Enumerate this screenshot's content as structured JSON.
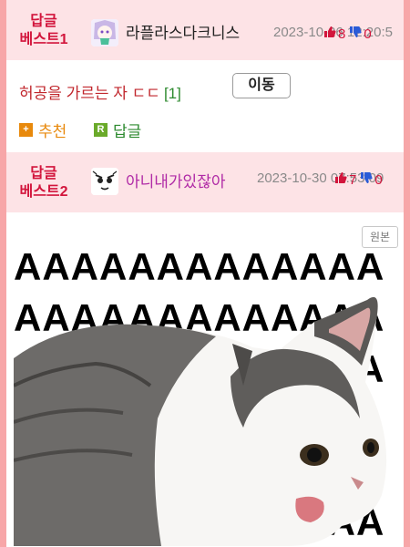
{
  "best1": {
    "label_line1": "답글",
    "label_line2": "베스트1",
    "nickname": "라플라스다크니스",
    "date": "2023-10-26",
    "time": "12:20:5",
    "votes_up": "8",
    "votes_down": "0"
  },
  "reply": {
    "title": "허공을 가르는 자 ㄷㄷ",
    "count": "[1]",
    "move_label": "이동",
    "recommend_label": "추천",
    "reply_label": "답글",
    "recommend_icon": "+",
    "reply_icon": "R"
  },
  "best2": {
    "label_line1": "답글",
    "label_line2": "베스트2",
    "nickname": "아니내가있잖아",
    "date": "2023-10-30",
    "time": "07:53:09",
    "votes_up": "7",
    "votes_down": "0"
  },
  "content": {
    "original_label": "원본",
    "meme_letters": "AAAAAAAAAAAAA"
  },
  "colors": {
    "accent_red": "#d2153c",
    "reply_green": "#2d8a2f",
    "recommend_orange": "#e8890c",
    "reply_icon_green": "#6aaa2a",
    "nick2_purple": "#b02aa6"
  }
}
